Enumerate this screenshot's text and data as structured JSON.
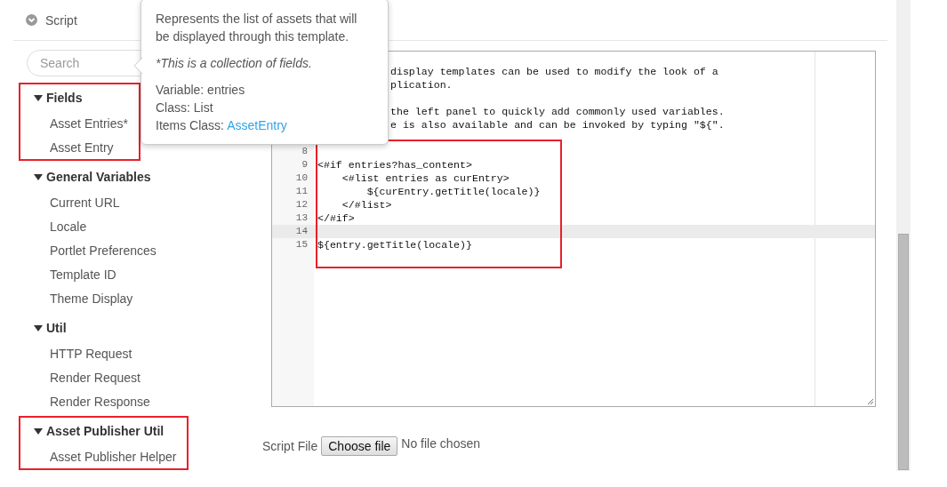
{
  "section": {
    "title": "Script",
    "expanded": true
  },
  "search": {
    "placeholder": "Search"
  },
  "groups": [
    {
      "title": "Fields",
      "expanded": true,
      "outlined": true,
      "items": [
        "Asset Entries*",
        "Asset Entry"
      ]
    },
    {
      "title": "General Variables",
      "expanded": true,
      "outlined": false,
      "items": [
        "Current URL",
        "Locale",
        "Portlet Preferences",
        "Template ID",
        "Theme Display"
      ]
    },
    {
      "title": "Util",
      "expanded": true,
      "outlined": false,
      "items": [
        "HTTP Request",
        "Render Request",
        "Render Response"
      ]
    },
    {
      "title": "Asset Publisher Util",
      "expanded": true,
      "outlined": true,
      "items": [
        "Asset Publisher Helper"
      ]
    }
  ],
  "tooltip": {
    "description": "Represents the list of assets that will be displayed through this template.",
    "note": "*This is a collection of fields.",
    "variable": "Variable: entries",
    "class": "Class: List",
    "items_class_label": "Items Class:",
    "items_class_link": "AssetEntry"
  },
  "editor": {
    "blocks": [
      {
        "outlined": false,
        "lines": [
          {
            "kind": "covered"
          },
          {
            "kind": "partial",
            "text": "display templates can be used to modify the look of a"
          },
          {
            "kind": "partial",
            "text": "plication."
          },
          {
            "kind": "covered"
          },
          {
            "kind": "partial",
            "text": "the left panel to quickly add commonly used variables."
          },
          {
            "kind": "partial",
            "text": "e is also available and can be invoked by typing \"${\"."
          },
          {
            "kind": "covered"
          }
        ]
      },
      {
        "outlined": true,
        "lines": [
          {
            "kind": "full",
            "number": "8",
            "active": false
          },
          {
            "kind": "full",
            "number": "9",
            "text": "<#if entries?has_content>",
            "active": false
          },
          {
            "kind": "full",
            "number": "10",
            "text": "    <#list entries as curEntry>",
            "active": false
          },
          {
            "kind": "full",
            "number": "11",
            "text": "        ${curEntry.getTitle(locale)}",
            "active": false
          },
          {
            "kind": "full",
            "number": "12",
            "text": "    </#list>",
            "active": false
          },
          {
            "kind": "full",
            "number": "13",
            "text": "</#if>",
            "active": false
          },
          {
            "kind": "full",
            "number": "14",
            "active": true
          },
          {
            "kind": "full",
            "number": "15",
            "text": "${entry.getTitle(locale)}",
            "active": false
          }
        ]
      }
    ]
  },
  "file_input": {
    "label": "Script File",
    "button": "Choose file",
    "status": "No file chosen"
  }
}
